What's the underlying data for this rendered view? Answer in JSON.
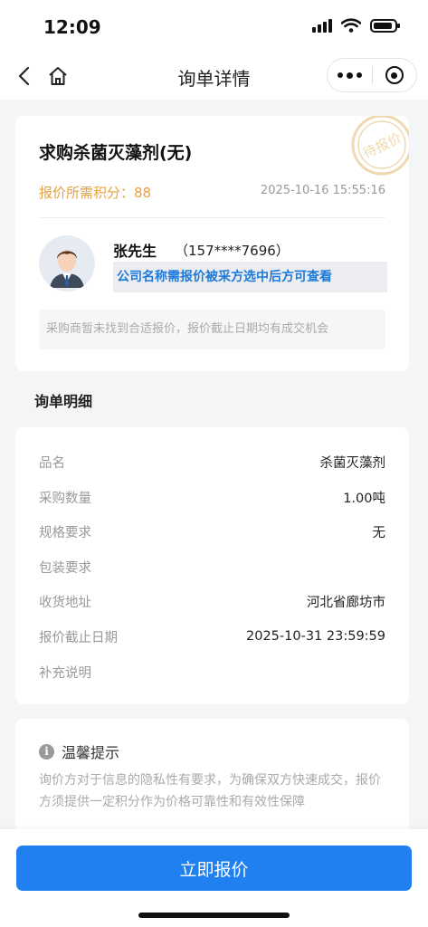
{
  "status_bar": {
    "time": "12:09",
    "icons": [
      "signal-icon",
      "wifi-icon",
      "battery-icon"
    ]
  },
  "nav": {
    "title": "询单详情",
    "back_icon": "back-arrow-icon",
    "home_icon": "home-icon",
    "more_icon": "more-dots-icon",
    "close_icon": "target-close-icon"
  },
  "inquiry": {
    "title": "求购杀菌灭藻剂(无)",
    "stamp_text": "待报价",
    "points_label": "报价所需积分：",
    "points_value": "88",
    "date": "2025-10-16 15:55:16",
    "buyer_name": "张先生",
    "buyer_phone": "（157****7696）",
    "company_note": "公司名称需报价被采方选中后方可查看",
    "tip": "采购商暂未找到合适报价，报价截止日期均有成交机会"
  },
  "details": {
    "section_title": "询单明细",
    "rows": [
      {
        "label": "品名",
        "value": "杀菌灭藻剂"
      },
      {
        "label": "采购数量",
        "value": "1.00吨"
      },
      {
        "label": "规格要求",
        "value": "无"
      },
      {
        "label": "包装要求",
        "value": ""
      },
      {
        "label": "收货地址",
        "value": "河北省廊坊市"
      },
      {
        "label": "报价截止日期",
        "value": "2025-10-31 23:59:59"
      },
      {
        "label": "补充说明",
        "value": ""
      }
    ]
  },
  "notice": {
    "icon": "info-icon",
    "title": "温馨提示",
    "text": "询价方对于信息的隐私性有要求，为确保双方快速成交，报价方须提供一定积分作为价格可靠性和有效性保障"
  },
  "action": {
    "button_label": "立即报价"
  },
  "colors": {
    "accent": "#2080f0",
    "points": "#e6a23c",
    "link": "#1d7ad8",
    "stamp": "#f0d9b0"
  }
}
